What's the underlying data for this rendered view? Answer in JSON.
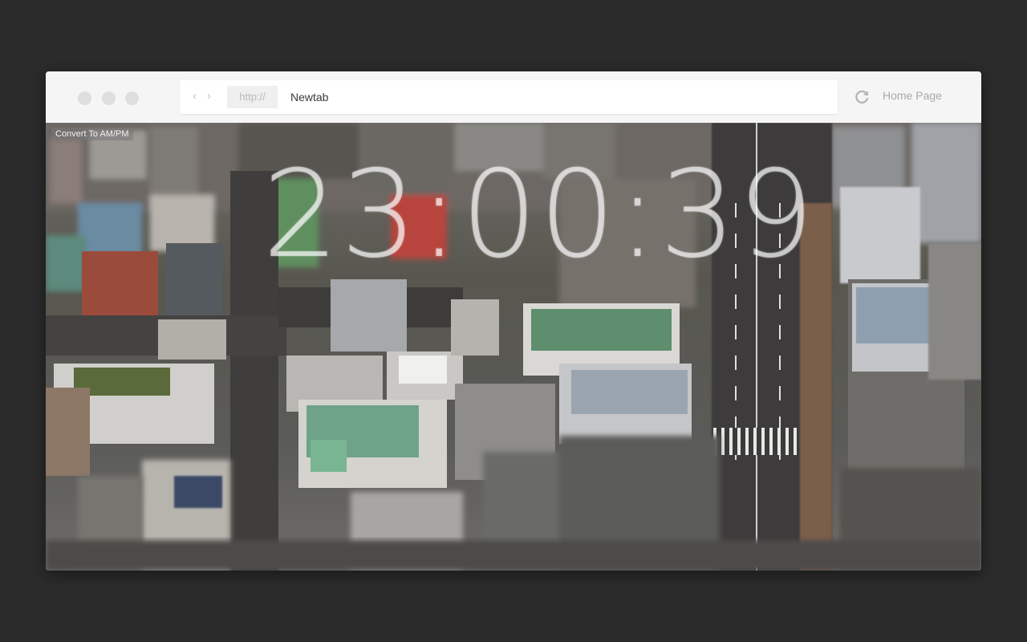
{
  "browser": {
    "protocol": "http://",
    "address": "Newtab",
    "home_label": "Home Page",
    "nav_back_glyph": "‹",
    "nav_forward_glyph": "›"
  },
  "newtab": {
    "ampm_button_label": "Convert To AM/PM",
    "clock_time": "23:00:39",
    "background": "aerial tilt-shift city photo"
  },
  "colors": {
    "desktop": "#2b2b2b",
    "toolbar": "#f5f5f5",
    "url_text": "#3a3a3a",
    "muted": "#a9a9a9"
  },
  "icons": [
    "window-close-icon",
    "window-minimize-icon",
    "window-zoom-icon",
    "back-arrow-icon",
    "forward-arrow-icon",
    "reload-icon"
  ]
}
